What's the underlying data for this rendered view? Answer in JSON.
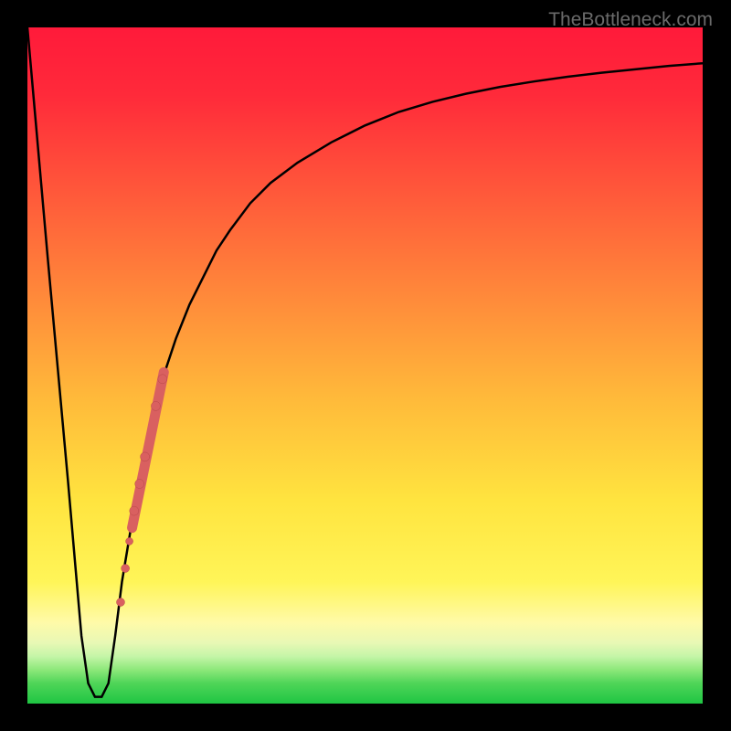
{
  "watermark": "TheBottleneck.com",
  "colors": {
    "top_red": "#ff1a3a",
    "mid_red": "#ff3a3a",
    "orange": "#ff8a3a",
    "yellow": "#ffef3f",
    "pale_yellow": "#fff9b5",
    "pale_green": "#c5f5a8",
    "green": "#3fd853",
    "bright_green": "#1fc543",
    "curve": "#000000",
    "marker_fill": "#d96060",
    "marker_stroke": "#b84848"
  },
  "chart_data": {
    "type": "line",
    "title": "",
    "xlabel": "",
    "ylabel": "",
    "xlim": [
      0,
      100
    ],
    "ylim": [
      0,
      100
    ],
    "x": [
      0,
      3,
      6,
      8,
      9,
      10,
      11,
      12,
      13,
      14,
      16,
      18,
      20,
      22,
      24,
      26,
      28,
      30,
      33,
      36,
      40,
      45,
      50,
      55,
      60,
      65,
      70,
      75,
      80,
      85,
      90,
      95,
      100
    ],
    "y": [
      100,
      66,
      33,
      10,
      3,
      1,
      1,
      3,
      10,
      18,
      30,
      40,
      48,
      54,
      59,
      63,
      67,
      70,
      74,
      77,
      80,
      83,
      85.5,
      87.5,
      89,
      90.2,
      91.2,
      92,
      92.7,
      93.3,
      93.8,
      94.3,
      94.7
    ],
    "markers": [
      {
        "x": 20,
        "y": 48,
        "r": 5
      },
      {
        "x": 19,
        "y": 44,
        "r": 5
      },
      {
        "x": 17.4,
        "y": 36.5,
        "r": 5
      },
      {
        "x": 16.6,
        "y": 32.5,
        "r": 5
      },
      {
        "x": 15.8,
        "y": 28.5,
        "r": 5
      },
      {
        "x": 15.1,
        "y": 24,
        "r": 4
      },
      {
        "x": 14.5,
        "y": 20,
        "r": 4.5
      },
      {
        "x": 13.8,
        "y": 15,
        "r": 4.5
      }
    ],
    "line_segment": {
      "x1": 15.5,
      "y1": 26,
      "x2": 20.2,
      "y2": 49,
      "width": 11
    }
  }
}
